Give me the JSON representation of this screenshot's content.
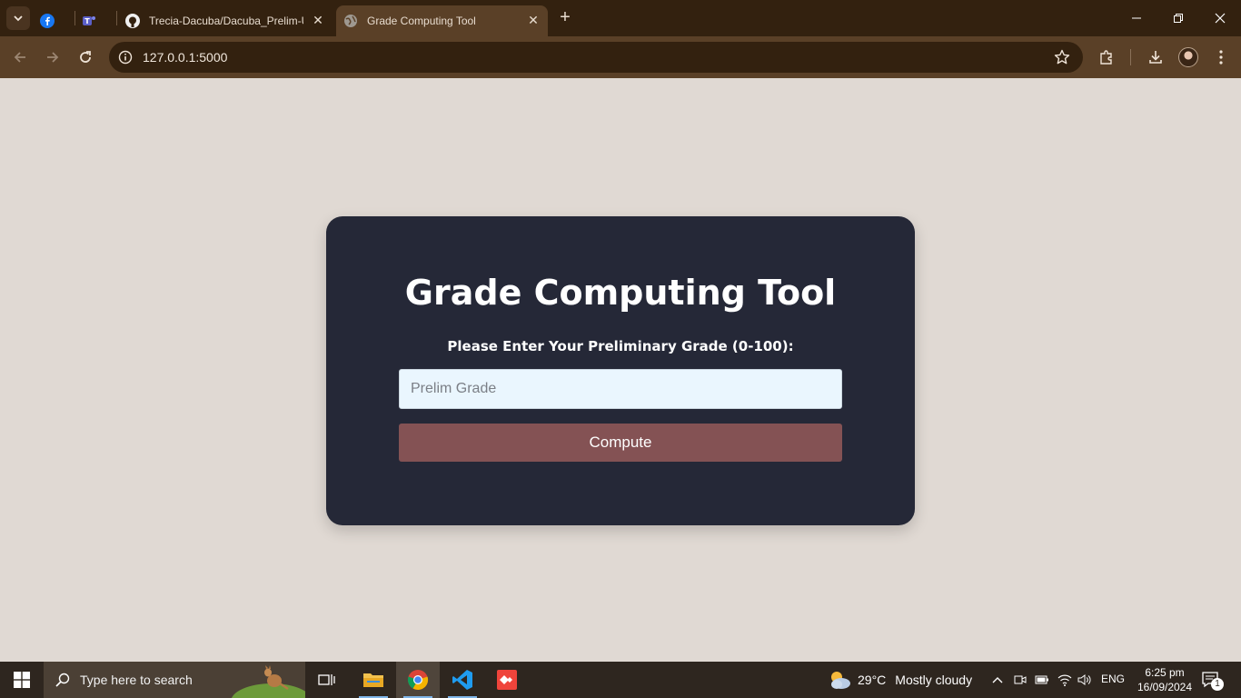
{
  "browser": {
    "tabs": [
      {
        "title": "",
        "icon": "facebook-icon",
        "active": false
      },
      {
        "title": "",
        "icon": "teams-icon",
        "active": false
      },
      {
        "title": "Trecia-Dacuba/Dacuba_Prelim-U",
        "icon": "github-icon",
        "active": false
      },
      {
        "title": "Grade Computing Tool",
        "icon": "globe-icon",
        "active": true
      }
    ],
    "url": "127.0.0.1:5000"
  },
  "page": {
    "title": "Grade Computing Tool",
    "prompt": "Please Enter Your Preliminary Grade (0-100):",
    "input_placeholder": "Prelim Grade",
    "input_value": "",
    "button_label": "Compute"
  },
  "taskbar": {
    "search_placeholder": "Type here to search",
    "weather_temp": "29°C",
    "weather_desc": "Mostly cloudy",
    "language": "ENG",
    "time": "6:25 pm",
    "date": "16/09/2024",
    "notification_count": "1"
  },
  "colors": {
    "page_bg": "#e0d9d3",
    "card_bg": "#252837",
    "button_bg": "#845254",
    "input_bg": "#eaf6fe",
    "chrome_dark": "#33210f",
    "chrome_toolbar": "#5a4027"
  }
}
